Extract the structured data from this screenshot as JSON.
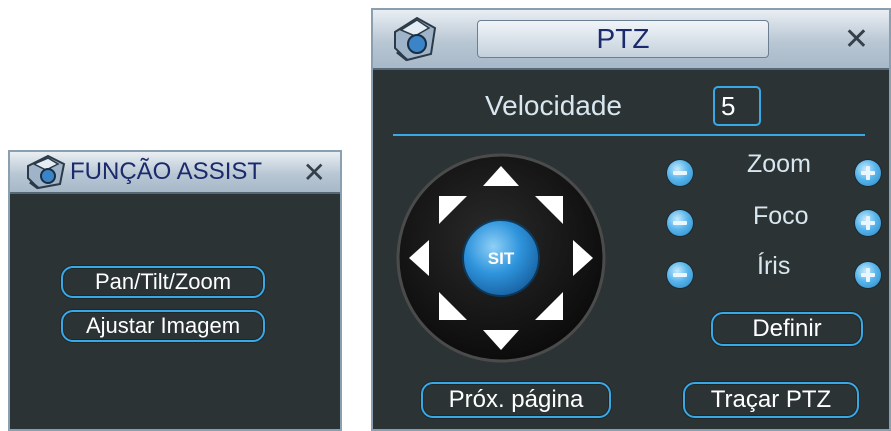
{
  "assist_window": {
    "title": "FUNÇÃO ASSIST",
    "close_icon": "close-icon",
    "buttons": {
      "pan_tilt_zoom": "Pan/Tilt/Zoom",
      "adjust_image": "Ajustar Imagem"
    }
  },
  "ptz_window": {
    "title": "PTZ",
    "close_icon": "close-icon",
    "speed_label": "Velocidade",
    "speed_value": "5",
    "center_label": "SIT",
    "controls": {
      "zoom": "Zoom",
      "focus": "Foco",
      "iris": "Íris"
    },
    "set_button": "Definir",
    "next_page_button": "Próx. página",
    "trace_button": "Traçar PTZ"
  },
  "colors": {
    "panel_bg": "#2b3334",
    "accent": "#39a8e6",
    "title_text": "#1a2a6c"
  }
}
